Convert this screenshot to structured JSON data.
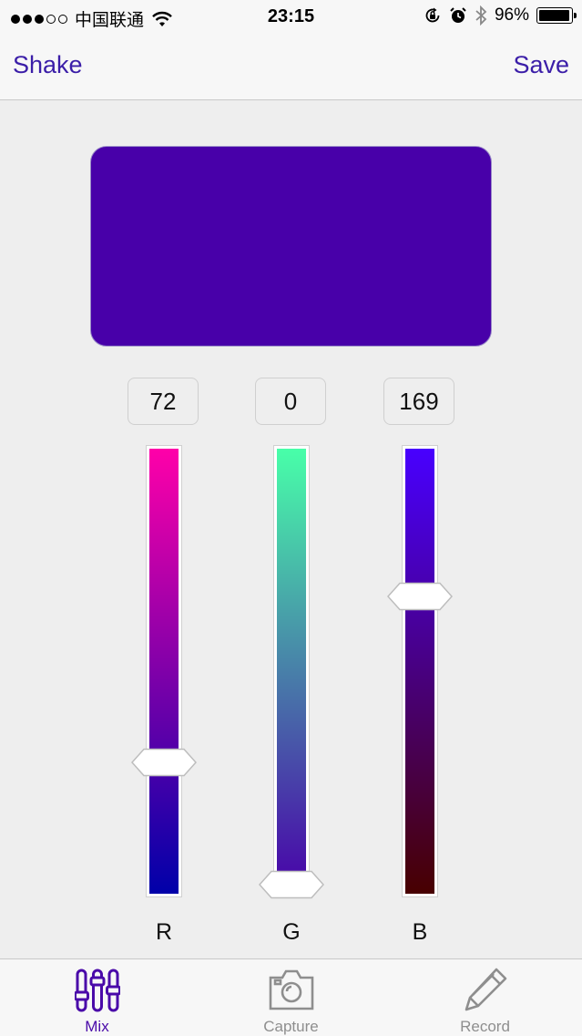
{
  "status_bar": {
    "carrier": "中国联通",
    "time": "23:15",
    "battery_text": "96%",
    "battery_level": 0.96,
    "signal_bars_filled": 3,
    "signal_bars_total": 5
  },
  "nav": {
    "left_label": "Shake",
    "right_label": "Save"
  },
  "color": {
    "r": 72,
    "g": 0,
    "b": 169,
    "swatch_hex": "#4800a9"
  },
  "sliders": [
    {
      "channel": "r",
      "label": "R",
      "value": "72",
      "level": 0.282,
      "top_color": "#ff00a9",
      "bottom_color": "#0000a9"
    },
    {
      "channel": "g",
      "label": "G",
      "value": "0",
      "level": 0.0,
      "top_color": "#48ffa9",
      "bottom_color": "#4800a9"
    },
    {
      "channel": "b",
      "label": "B",
      "value": "169",
      "level": 0.663,
      "top_color": "#4800ff",
      "bottom_color": "#480000"
    }
  ],
  "tabs": [
    {
      "label": "Mix",
      "icon": "sliders-icon",
      "active": true
    },
    {
      "label": "Capture",
      "icon": "camera-icon",
      "active": false
    },
    {
      "label": "Record",
      "icon": "pencil-icon",
      "active": false
    }
  ],
  "colors": {
    "accent": "#3b1ea8",
    "tab_active": "#4a0aa9",
    "tab_inactive": "#8e8e8e"
  }
}
